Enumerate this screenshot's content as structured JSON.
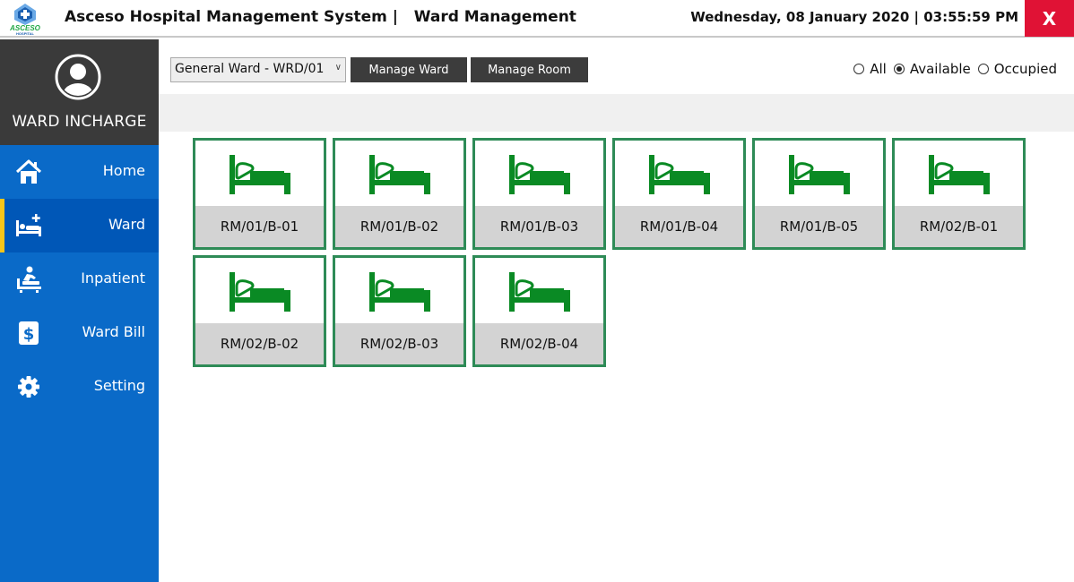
{
  "titlebar": {
    "logo_text": "ASCESO",
    "logo_subtext": "HOSPITAL",
    "app_title": "Asceso Hospital Management System |   Ward Management",
    "datetime": "Wednesday, 08 January 2020 | 03:55:59 PM",
    "close_label": "X",
    "close_color": "#e01235"
  },
  "sidebar": {
    "role": "WARD INCHARGE",
    "accent": "#0a6ac8",
    "active_indicator_color": "#f7c51a",
    "items": [
      {
        "label": "Home",
        "icon": "home-icon"
      },
      {
        "label": "Ward",
        "icon": "bed-plus-icon",
        "active": true
      },
      {
        "label": "Inpatient",
        "icon": "patient-bed-icon"
      },
      {
        "label": "Ward Bill",
        "icon": "dollar-bill-icon"
      },
      {
        "label": "Setting",
        "icon": "gear-icon"
      }
    ]
  },
  "toolbar": {
    "ward_selected": "General Ward - WRD/01",
    "manage_ward": "Manage Ward",
    "manage_room": "Manage Room",
    "filters": [
      {
        "label": "All",
        "checked": false
      },
      {
        "label": "Available",
        "checked": true
      },
      {
        "label": "Occupied",
        "checked": false
      }
    ]
  },
  "beds": [
    {
      "label": "RM/01/B-01"
    },
    {
      "label": "RM/01/B-02"
    },
    {
      "label": "RM/01/B-03"
    },
    {
      "label": "RM/01/B-04"
    },
    {
      "label": "RM/01/B-05"
    },
    {
      "label": "RM/02/B-01"
    },
    {
      "label": "RM/02/B-02"
    },
    {
      "label": "RM/02/B-03"
    },
    {
      "label": "RM/02/B-04"
    }
  ],
  "bed_color": "#0a8a24",
  "card_border_color": "#2e8b57"
}
